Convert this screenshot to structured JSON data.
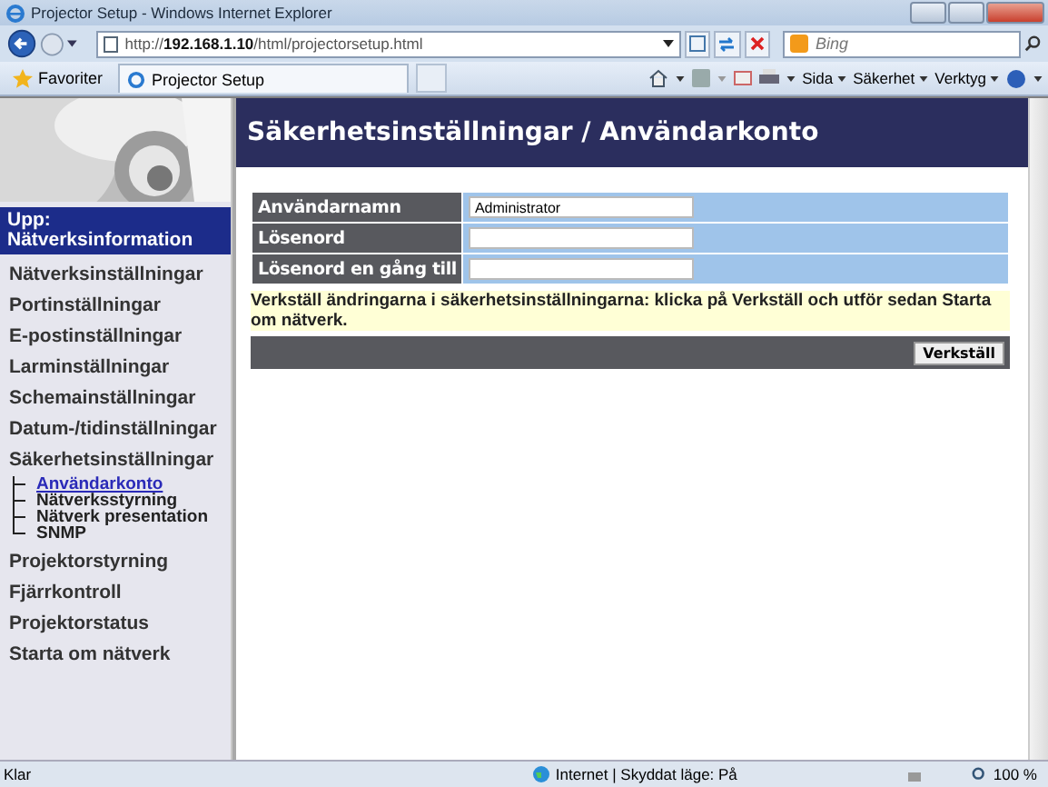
{
  "window": {
    "title": "Projector Setup - Windows Internet Explorer"
  },
  "browser": {
    "address": "http://**192.168.1.10**/html/projectorsetup.html",
    "search_placeholder": "Bing",
    "favorites": "Favoriter",
    "tab": "Projector Setup",
    "menus": [
      "Sida",
      "Säkerhet",
      "Verktyg"
    ]
  },
  "sidebar": {
    "up_link": "Upp: Nätverksinformation",
    "items": [
      {
        "label": "Nätverksinställningar"
      },
      {
        "label": "Portinställningar"
      },
      {
        "label": "E-postinställningar"
      },
      {
        "label": "Larminställningar"
      },
      {
        "label": "Schemainställningar"
      },
      {
        "label": "Datum-/tidinställningar"
      },
      {
        "label": "Säkerhetsinställningar",
        "children": [
          {
            "label": "Användarkonto",
            "selected": true
          },
          {
            "label": "Nätverksstyrning",
            "selected": false
          },
          {
            "label": "Nätverk presentation",
            "selected": false
          },
          {
            "label": "SNMP",
            "selected": false
          }
        ]
      },
      {
        "label": "Projektorstyrning"
      },
      {
        "label": "Fjärrkontroll"
      },
      {
        "label": "Projektorstatus"
      },
      {
        "label": "Starta om nätverk"
      }
    ]
  },
  "page": {
    "heading": "Säkerhetsinställningar / Användarkonto",
    "fields": [
      {
        "label": "Användarnamn",
        "value": "Administrator"
      },
      {
        "label": "Lösenord"
      },
      {
        "label": "Lösenord en gång till"
      }
    ],
    "notice": "Verkställ ändringarna i säkerhetsinställningarna: klicka på Verkställ och utför sedan Starta om nätverk.",
    "apply_button": "Verkställ"
  },
  "status_bar": {
    "text": "Klar",
    "zone": "Internet | Skyddat läge: På",
    "zoom": "100 %"
  }
}
